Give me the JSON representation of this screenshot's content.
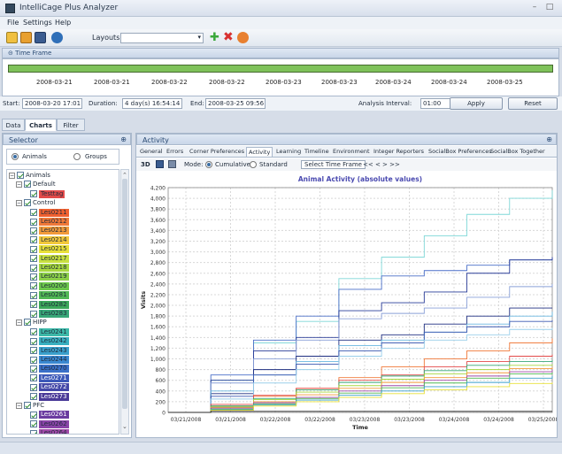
{
  "window": {
    "title": "IntelliCage Plus Analyzer",
    "minimize": "–",
    "maximize": "□",
    "close": "×"
  },
  "menu": [
    "File",
    "Settings",
    "Help"
  ],
  "toolbar": {
    "layouts_label": "Layouts:",
    "layouts_value": ""
  },
  "time_frame": {
    "title": "Time Frame",
    "dates": [
      "2008-03-21",
      "2008-03-21",
      "2008-03-22",
      "2008-03-22",
      "2008-03-23",
      "2008-03-23",
      "2008-03-24",
      "2008-03-24",
      "2008-03-25"
    ]
  },
  "info": {
    "start_label": "Start:",
    "start_value": "2008-03-20 17:01",
    "duration_label": "Duration:",
    "duration_value": "4 day(s) 16:54:14",
    "end_label": "End:",
    "end_value": "2008-03-25 09:56",
    "interval_label": "Analysis Interval:",
    "interval_value": "01:00",
    "apply": "Apply",
    "reset": "Reset"
  },
  "main_tabs": [
    "Data",
    "Charts",
    "Filter"
  ],
  "selector": {
    "title": "Selector",
    "radio_animals": "Animals",
    "radio_groups": "Groups",
    "root": "Animals",
    "groups": [
      {
        "name": "Default",
        "animals": [
          {
            "name": "Testtag",
            "color": "#e24a4a"
          }
        ]
      },
      {
        "name": "Control",
        "animals": [
          {
            "name": "Les0211",
            "color": "#f06030"
          },
          {
            "name": "Les0212",
            "color": "#f07838"
          },
          {
            "name": "Les0213",
            "color": "#f29a3a"
          },
          {
            "name": "Les0214",
            "color": "#f2c83a"
          },
          {
            "name": "Les0215",
            "color": "#e8e038"
          },
          {
            "name": "Les0217",
            "color": "#c8e040"
          },
          {
            "name": "Les0218",
            "color": "#a8d840"
          },
          {
            "name": "Les0219",
            "color": "#8cd048"
          },
          {
            "name": "Les0200",
            "color": "#6cc84c"
          },
          {
            "name": "Les0281",
            "color": "#50b854"
          },
          {
            "name": "Les0282",
            "color": "#3ca85a"
          },
          {
            "name": "Les0283",
            "color": "#38a878"
          }
        ]
      },
      {
        "name": "HIPP",
        "animals": [
          {
            "name": "Les0241",
            "color": "#3cb8a8"
          },
          {
            "name": "Les0242",
            "color": "#38b0c0"
          },
          {
            "name": "Les0243",
            "color": "#3aa0cc"
          },
          {
            "name": "Les0244",
            "color": "#3a88d0"
          },
          {
            "name": "Les0270",
            "color": "#3a70c8"
          },
          {
            "name": "Les0271",
            "color": "#3c58b8"
          },
          {
            "name": "Les0272",
            "color": "#4448a8"
          },
          {
            "name": "Les0273",
            "color": "#4a3a98"
          }
        ]
      },
      {
        "name": "PFC",
        "animals": [
          {
            "name": "Les0261",
            "color": "#6a3ca0"
          },
          {
            "name": "Les0262",
            "color": "#8a44a8"
          },
          {
            "name": "Les0264",
            "color": "#a04aa8"
          }
        ]
      }
    ]
  },
  "activity": {
    "title": "Activity",
    "tabs": [
      "General",
      "Errors",
      "Corner Preferences",
      "Activity",
      "Learning",
      "Timeline",
      "Environment",
      "Integer Reporters",
      "SocialBox Preferences",
      "SocialBox Together"
    ],
    "active_tab": "Activity",
    "toolbar": {
      "three_d": "3D",
      "mode_label": "Mode:",
      "cumulative": "Cumulative",
      "standard": "Standard",
      "select_time_frame": "Select Time Frame",
      "nav": "<< < > >>"
    }
  },
  "chart_data": {
    "type": "line",
    "title": "Animal Activity (absolute values)",
    "xlabel": "Time",
    "ylabel": "Visits",
    "ylim": [
      0,
      4200
    ],
    "yticks": [
      0,
      200,
      400,
      600,
      800,
      1000,
      1200,
      1400,
      1600,
      1800,
      2000,
      2200,
      2400,
      2600,
      2800,
      3000,
      3200,
      3400,
      3600,
      3800,
      4000,
      4200
    ],
    "xticks": [
      "03/21/2008",
      "03/21/2008",
      "03/22/2008",
      "03/22/2008",
      "03/23/2008",
      "03/23/2008",
      "03/24/2008",
      "03/24/2008",
      "03/25/2008"
    ],
    "grid": true,
    "x_hours": [
      0,
      12,
      24,
      36,
      48,
      60,
      72,
      84,
      96,
      108
    ],
    "series": [
      {
        "color": "#7fd8d8",
        "values": [
          0,
          600,
          1300,
          1700,
          2500,
          2900,
          3300,
          3700,
          4000,
          4150
        ]
      },
      {
        "color": "#4a6fc8",
        "values": [
          0,
          700,
          1350,
          1800,
          2300,
          2550,
          2650,
          2750,
          2850,
          2900
        ]
      },
      {
        "color": "#2a3c98",
        "values": [
          0,
          600,
          1150,
          1400,
          1900,
          2050,
          2250,
          2600,
          2850,
          2900
        ]
      },
      {
        "color": "#8aa0d8",
        "values": [
          0,
          550,
          1000,
          1350,
          1750,
          1850,
          1950,
          2150,
          2350,
          2400
        ]
      },
      {
        "color": "#1e2e80",
        "values": [
          0,
          350,
          800,
          1050,
          1350,
          1450,
          1650,
          1800,
          1950,
          1950
        ]
      },
      {
        "color": "#6ab8e0",
        "values": [
          0,
          400,
          700,
          950,
          1250,
          1350,
          1500,
          1650,
          1800,
          1880
        ]
      },
      {
        "color": "#3a58b0",
        "values": [
          0,
          300,
          700,
          900,
          1150,
          1300,
          1500,
          1600,
          1700,
          1720
        ]
      },
      {
        "color": "#9acfea",
        "values": [
          0,
          250,
          550,
          800,
          1050,
          1200,
          1350,
          1450,
          1550,
          1580
        ]
      },
      {
        "color": "#f07838",
        "values": [
          0,
          120,
          300,
          450,
          650,
          850,
          1000,
          1150,
          1300,
          1380
        ]
      },
      {
        "color": "#e24a4a",
        "values": [
          0,
          150,
          320,
          450,
          600,
          700,
          850,
          950,
          1050,
          1080
        ]
      },
      {
        "color": "#38a878",
        "values": [
          0,
          120,
          260,
          420,
          560,
          680,
          780,
          880,
          950,
          980
        ]
      },
      {
        "color": "#a8d840",
        "values": [
          0,
          100,
          240,
          380,
          500,
          620,
          720,
          800,
          880,
          900
        ]
      },
      {
        "color": "#f29a3a",
        "values": [
          0,
          90,
          200,
          330,
          450,
          560,
          650,
          740,
          820,
          850
        ]
      },
      {
        "color": "#a04aa8",
        "values": [
          0,
          80,
          180,
          280,
          400,
          500,
          600,
          680,
          760,
          800
        ]
      },
      {
        "color": "#50b854",
        "values": [
          0,
          60,
          160,
          260,
          360,
          460,
          550,
          640,
          720,
          750
        ]
      },
      {
        "color": "#3aa0cc",
        "values": [
          0,
          50,
          140,
          230,
          320,
          400,
          480,
          560,
          640,
          680
        ]
      },
      {
        "color": "#e8e038",
        "values": [
          0,
          40,
          120,
          200,
          280,
          350,
          420,
          480,
          540,
          560
        ]
      },
      {
        "color": "#2a2a2a",
        "values": [
          0,
          20,
          20,
          20,
          20,
          20,
          20,
          20,
          20,
          20
        ]
      }
    ]
  }
}
